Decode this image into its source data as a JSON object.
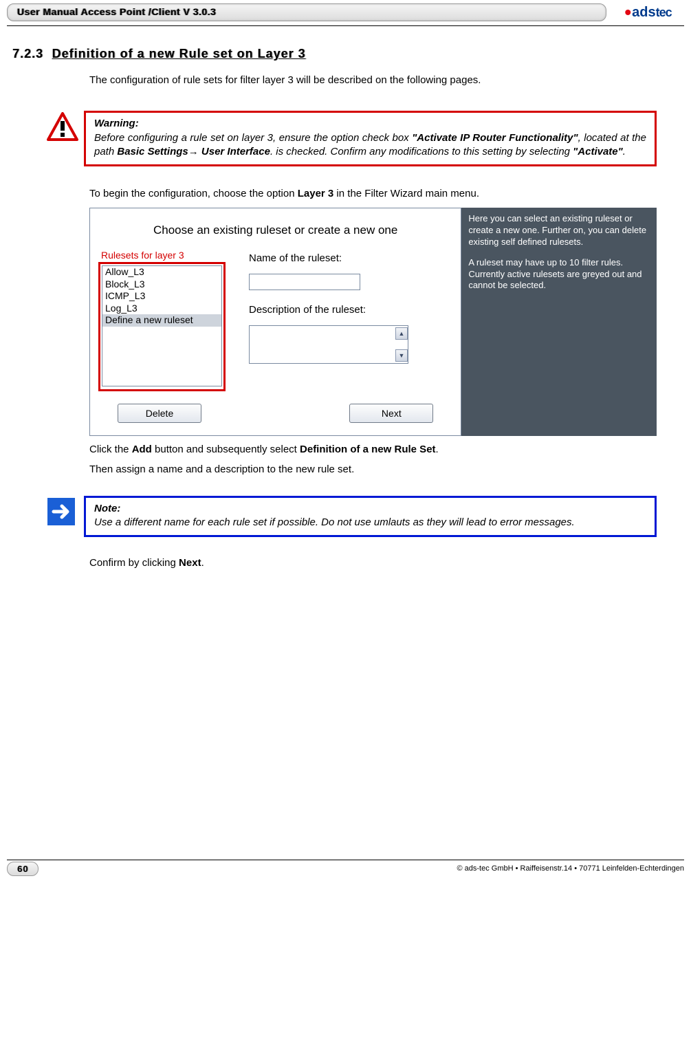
{
  "header": {
    "title": "User Manual Access Point /Client V 3.0.3",
    "logo_text_prefix": "ads",
    "logo_text_suffix": "tec"
  },
  "section": {
    "number": "7.2.3",
    "title": "Definition of a new Rule set on Layer 3"
  },
  "paragraphs": {
    "intro": "The configuration of rule sets for filter layer 3 will be described on the following pages.",
    "begin": "To begin the configuration, choose the option ",
    "begin_bold": "Layer 3",
    "begin_after": " in the Filter Wizard main menu.",
    "click1_a": "Click the ",
    "click1_b": "Add",
    "click1_c": " button and subsequently select ",
    "click1_d": "Definition of a new Rule Set",
    "click1_e": ".",
    "then": "Then assign a name and a description to the new rule set.",
    "confirm_a": "Confirm by clicking ",
    "confirm_b": "Next",
    "confirm_c": "."
  },
  "warning": {
    "title": "Warning:",
    "pre": "Before configuring a rule set on layer 3, ensure the option check box ",
    "q1": "\"Activate IP Router Functionality\"",
    "mid": ", located at the path ",
    "path": "Basic Settings→ User Interface",
    "post1": ".   is checked. Confirm any modifications to this setting by selecting ",
    "q2": "\"Activate\"",
    "post2": "."
  },
  "note": {
    "title": "Note:",
    "body": "Use a different name for each rule set if possible. Do not use umlauts as they will lead to error messages."
  },
  "screenshot": {
    "heading": "Choose an existing ruleset or create a new one",
    "list_label": "Rulesets for layer 3",
    "items": [
      "Allow_L3",
      "Block_L3",
      "ICMP_L3",
      "Log_L3",
      "Define a new ruleset"
    ],
    "selected_index": 4,
    "name_label": "Name of the ruleset:",
    "desc_label": "Description of the ruleset:",
    "btn_delete": "Delete",
    "btn_next": "Next",
    "side_p1": "Here you can select an existing ruleset or create a new one. Further on, you can delete existing self defined rulesets.",
    "side_p2": "A ruleset may have up to 10 filter rules. Currently active rulesets are greyed out and cannot be selected."
  },
  "footer": {
    "page": "60",
    "copyright": "© ads-tec GmbH • Raiffeisenstr.14 • 70771 Leinfelden-Echterdingen"
  }
}
